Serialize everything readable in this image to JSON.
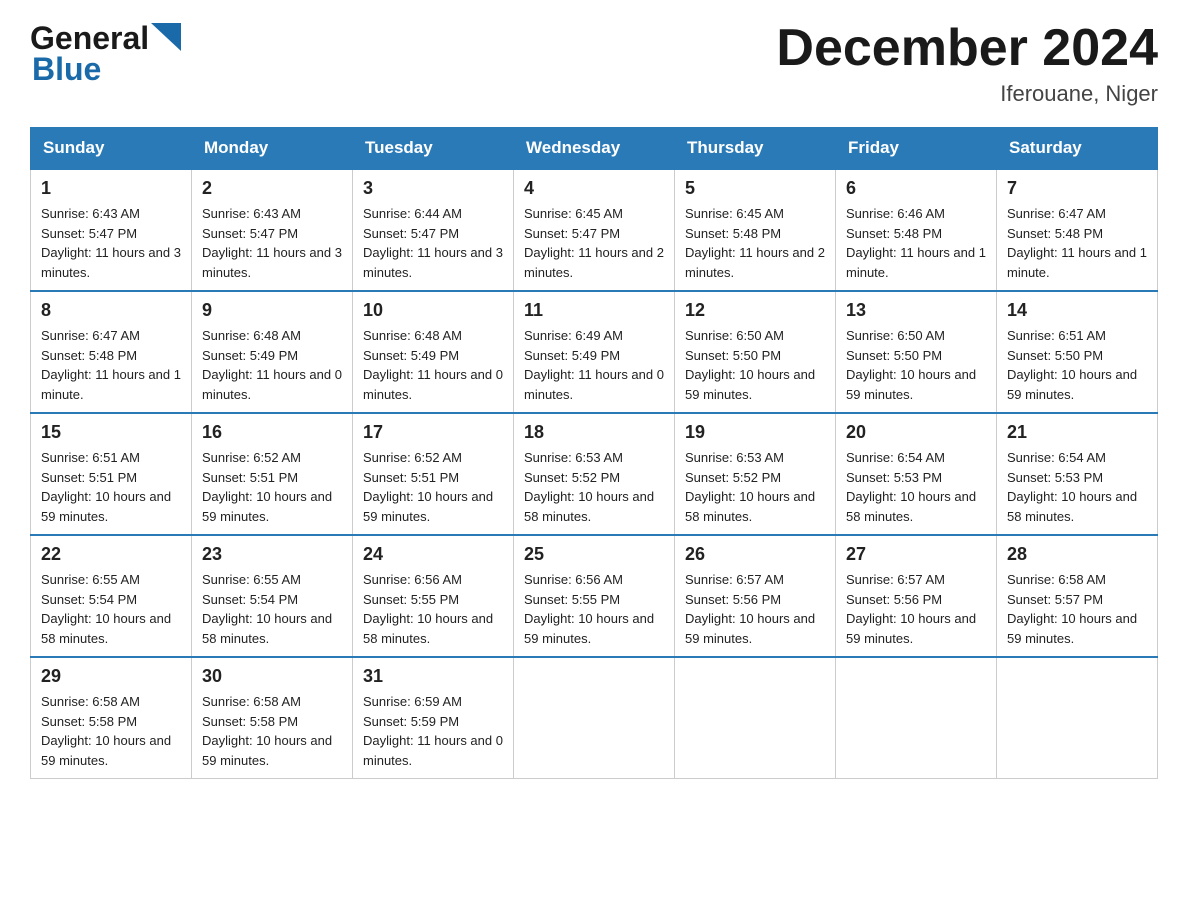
{
  "header": {
    "logo_general": "General",
    "logo_blue": "Blue",
    "month_title": "December 2024",
    "location": "Iferouane, Niger"
  },
  "days_of_week": [
    "Sunday",
    "Monday",
    "Tuesday",
    "Wednesday",
    "Thursday",
    "Friday",
    "Saturday"
  ],
  "weeks": [
    [
      {
        "day": "1",
        "sunrise": "Sunrise: 6:43 AM",
        "sunset": "Sunset: 5:47 PM",
        "daylight": "Daylight: 11 hours and 3 minutes."
      },
      {
        "day": "2",
        "sunrise": "Sunrise: 6:43 AM",
        "sunset": "Sunset: 5:47 PM",
        "daylight": "Daylight: 11 hours and 3 minutes."
      },
      {
        "day": "3",
        "sunrise": "Sunrise: 6:44 AM",
        "sunset": "Sunset: 5:47 PM",
        "daylight": "Daylight: 11 hours and 3 minutes."
      },
      {
        "day": "4",
        "sunrise": "Sunrise: 6:45 AM",
        "sunset": "Sunset: 5:47 PM",
        "daylight": "Daylight: 11 hours and 2 minutes."
      },
      {
        "day": "5",
        "sunrise": "Sunrise: 6:45 AM",
        "sunset": "Sunset: 5:48 PM",
        "daylight": "Daylight: 11 hours and 2 minutes."
      },
      {
        "day": "6",
        "sunrise": "Sunrise: 6:46 AM",
        "sunset": "Sunset: 5:48 PM",
        "daylight": "Daylight: 11 hours and 1 minute."
      },
      {
        "day": "7",
        "sunrise": "Sunrise: 6:47 AM",
        "sunset": "Sunset: 5:48 PM",
        "daylight": "Daylight: 11 hours and 1 minute."
      }
    ],
    [
      {
        "day": "8",
        "sunrise": "Sunrise: 6:47 AM",
        "sunset": "Sunset: 5:48 PM",
        "daylight": "Daylight: 11 hours and 1 minute."
      },
      {
        "day": "9",
        "sunrise": "Sunrise: 6:48 AM",
        "sunset": "Sunset: 5:49 PM",
        "daylight": "Daylight: 11 hours and 0 minutes."
      },
      {
        "day": "10",
        "sunrise": "Sunrise: 6:48 AM",
        "sunset": "Sunset: 5:49 PM",
        "daylight": "Daylight: 11 hours and 0 minutes."
      },
      {
        "day": "11",
        "sunrise": "Sunrise: 6:49 AM",
        "sunset": "Sunset: 5:49 PM",
        "daylight": "Daylight: 11 hours and 0 minutes."
      },
      {
        "day": "12",
        "sunrise": "Sunrise: 6:50 AM",
        "sunset": "Sunset: 5:50 PM",
        "daylight": "Daylight: 10 hours and 59 minutes."
      },
      {
        "day": "13",
        "sunrise": "Sunrise: 6:50 AM",
        "sunset": "Sunset: 5:50 PM",
        "daylight": "Daylight: 10 hours and 59 minutes."
      },
      {
        "day": "14",
        "sunrise": "Sunrise: 6:51 AM",
        "sunset": "Sunset: 5:50 PM",
        "daylight": "Daylight: 10 hours and 59 minutes."
      }
    ],
    [
      {
        "day": "15",
        "sunrise": "Sunrise: 6:51 AM",
        "sunset": "Sunset: 5:51 PM",
        "daylight": "Daylight: 10 hours and 59 minutes."
      },
      {
        "day": "16",
        "sunrise": "Sunrise: 6:52 AM",
        "sunset": "Sunset: 5:51 PM",
        "daylight": "Daylight: 10 hours and 59 minutes."
      },
      {
        "day": "17",
        "sunrise": "Sunrise: 6:52 AM",
        "sunset": "Sunset: 5:51 PM",
        "daylight": "Daylight: 10 hours and 59 minutes."
      },
      {
        "day": "18",
        "sunrise": "Sunrise: 6:53 AM",
        "sunset": "Sunset: 5:52 PM",
        "daylight": "Daylight: 10 hours and 58 minutes."
      },
      {
        "day": "19",
        "sunrise": "Sunrise: 6:53 AM",
        "sunset": "Sunset: 5:52 PM",
        "daylight": "Daylight: 10 hours and 58 minutes."
      },
      {
        "day": "20",
        "sunrise": "Sunrise: 6:54 AM",
        "sunset": "Sunset: 5:53 PM",
        "daylight": "Daylight: 10 hours and 58 minutes."
      },
      {
        "day": "21",
        "sunrise": "Sunrise: 6:54 AM",
        "sunset": "Sunset: 5:53 PM",
        "daylight": "Daylight: 10 hours and 58 minutes."
      }
    ],
    [
      {
        "day": "22",
        "sunrise": "Sunrise: 6:55 AM",
        "sunset": "Sunset: 5:54 PM",
        "daylight": "Daylight: 10 hours and 58 minutes."
      },
      {
        "day": "23",
        "sunrise": "Sunrise: 6:55 AM",
        "sunset": "Sunset: 5:54 PM",
        "daylight": "Daylight: 10 hours and 58 minutes."
      },
      {
        "day": "24",
        "sunrise": "Sunrise: 6:56 AM",
        "sunset": "Sunset: 5:55 PM",
        "daylight": "Daylight: 10 hours and 58 minutes."
      },
      {
        "day": "25",
        "sunrise": "Sunrise: 6:56 AM",
        "sunset": "Sunset: 5:55 PM",
        "daylight": "Daylight: 10 hours and 59 minutes."
      },
      {
        "day": "26",
        "sunrise": "Sunrise: 6:57 AM",
        "sunset": "Sunset: 5:56 PM",
        "daylight": "Daylight: 10 hours and 59 minutes."
      },
      {
        "day": "27",
        "sunrise": "Sunrise: 6:57 AM",
        "sunset": "Sunset: 5:56 PM",
        "daylight": "Daylight: 10 hours and 59 minutes."
      },
      {
        "day": "28",
        "sunrise": "Sunrise: 6:58 AM",
        "sunset": "Sunset: 5:57 PM",
        "daylight": "Daylight: 10 hours and 59 minutes."
      }
    ],
    [
      {
        "day": "29",
        "sunrise": "Sunrise: 6:58 AM",
        "sunset": "Sunset: 5:58 PM",
        "daylight": "Daylight: 10 hours and 59 minutes."
      },
      {
        "day": "30",
        "sunrise": "Sunrise: 6:58 AM",
        "sunset": "Sunset: 5:58 PM",
        "daylight": "Daylight: 10 hours and 59 minutes."
      },
      {
        "day": "31",
        "sunrise": "Sunrise: 6:59 AM",
        "sunset": "Sunset: 5:59 PM",
        "daylight": "Daylight: 11 hours and 0 minutes."
      },
      null,
      null,
      null,
      null
    ]
  ]
}
